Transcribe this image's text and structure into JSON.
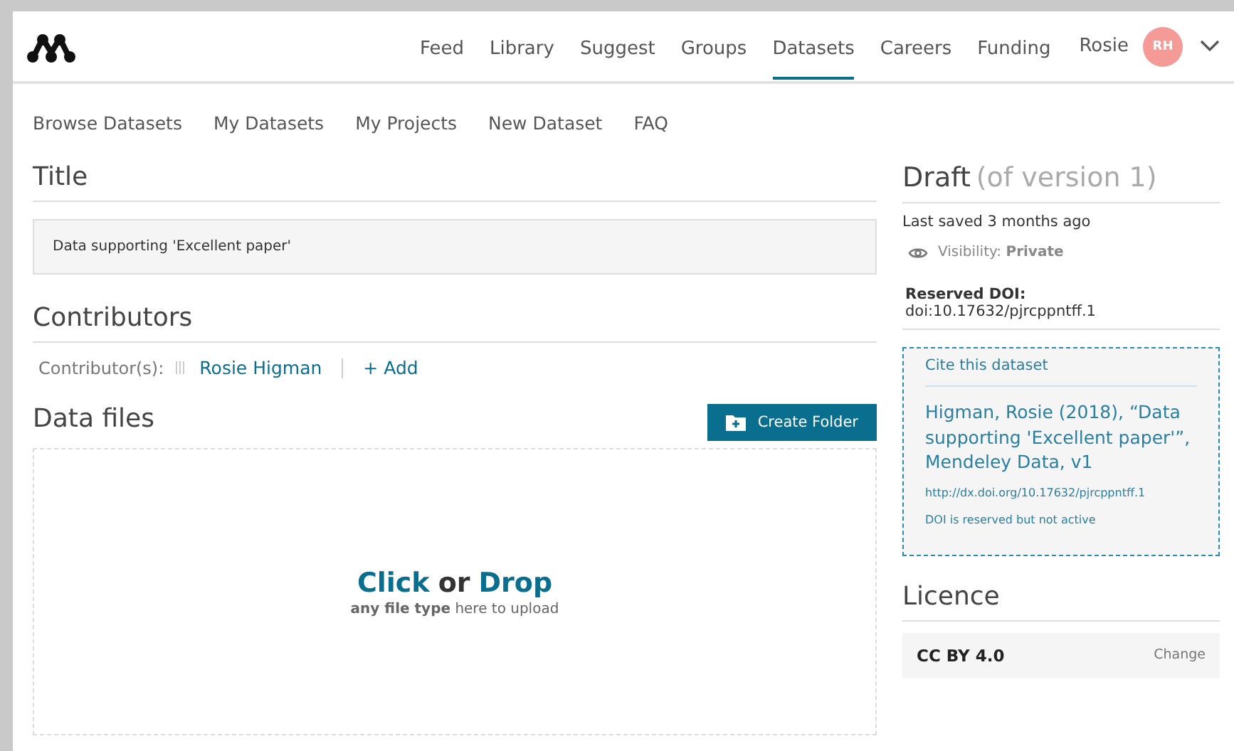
{
  "nav": {
    "items": [
      {
        "label": "Feed",
        "selected": false
      },
      {
        "label": "Library",
        "selected": false
      },
      {
        "label": "Suggest",
        "selected": false
      },
      {
        "label": "Groups",
        "selected": false
      },
      {
        "label": "Datasets",
        "selected": true
      },
      {
        "label": "Careers",
        "selected": false
      },
      {
        "label": "Funding",
        "selected": false
      }
    ],
    "user_name": "Rosie",
    "avatar_initials": "RH"
  },
  "subnav": [
    "Browse Datasets",
    "My Datasets",
    "My Projects",
    "New Dataset",
    "FAQ"
  ],
  "title_section": {
    "heading": "Title",
    "value": "Data supporting 'Excellent paper'"
  },
  "contributors_section": {
    "heading": "Contributors",
    "label": "Contributor(s):",
    "contributors": [
      "Rosie Higman"
    ],
    "add_label": "+ Add"
  },
  "data_files": {
    "heading": "Data files",
    "create_folder": "Create Folder",
    "drop_click": "Click",
    "drop_or": "or",
    "drop_drop": "Drop",
    "drop_hint": "**any file type** here to upload"
  },
  "sidebar": {
    "status": "Draft",
    "version_note": "(of version 1)",
    "last_saved": "Last saved 3 months ago",
    "visibility": "Visibility: **Private**",
    "reserved_doi": "**Reserved DOI:** doi:10.17632/pjrcppntff.1",
    "cite": {
      "heading": "Cite this dataset",
      "citation": "Higman, Rosie (2018), “Data supporting 'Excellent paper'”, Mendeley Data, v1",
      "url": "http://dx.doi.org/10.17632/pjrcppntff.1",
      "note": "DOI is reserved but not active"
    },
    "licence": {
      "heading": "Licence",
      "value": "CC BY 4.0",
      "change": "Change"
    }
  }
}
